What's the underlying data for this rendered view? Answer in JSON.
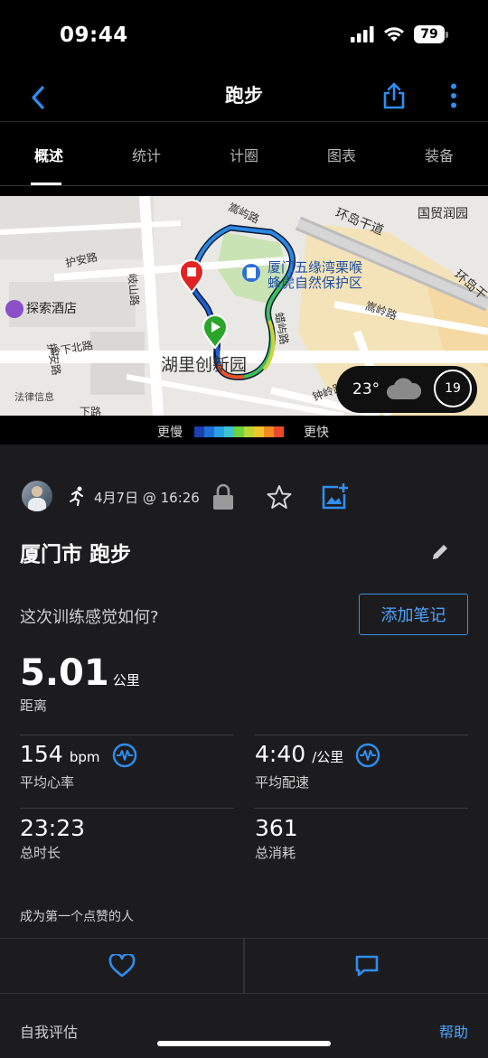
{
  "status_bar": {
    "time": "09:44",
    "battery": "79"
  },
  "nav": {
    "title": "跑步",
    "back_icon": "chevron-left-icon",
    "share_icon": "share-icon",
    "more_icon": "more-vertical-icon"
  },
  "tabs": [
    {
      "label": "概述",
      "active": true
    },
    {
      "label": "统计",
      "active": false
    },
    {
      "label": "计圈",
      "active": false
    },
    {
      "label": "图表",
      "active": false
    },
    {
      "label": "装备",
      "active": false
    }
  ],
  "map": {
    "labels": {
      "road_top": "嵩屿路",
      "ring_road": "环岛干道",
      "ring_road_2": "环岛干",
      "guomao": "国贸润园",
      "huan_road": "护安路",
      "jishan_road": "岐山路",
      "hotel": "探索酒店",
      "ling_north": "岭下北路",
      "huan_road_2": "护安路",
      "xialing": "下岭路",
      "poi_line1": "厦门五缘湾栗喉",
      "poi_line2": "蜂虎自然保护区",
      "songling": "嵩岭路",
      "shuxiang": "蜡屿路",
      "area": "湖里创新园",
      "legal": "法律信息",
      "zhongling": "钟岭路",
      "xiaroad": "下路"
    },
    "weather": {
      "temperature": "23°",
      "condition_icon": "cloud-icon",
      "wind": "19"
    }
  },
  "pace_legend": {
    "slower": "更慢",
    "faster": "更快",
    "colors": [
      "#1a3fb0",
      "#1e6fd6",
      "#2aa0e8",
      "#3cc2d0",
      "#6cd23f",
      "#b7d832",
      "#f0c52a",
      "#f28a22",
      "#ea4a2a"
    ]
  },
  "activity": {
    "date": "4月7日 @ 16:26",
    "title": "厦门市 跑步",
    "feel_question": "这次训练感觉如何?",
    "add_note": "添加笔记",
    "distance": {
      "value": "5.01",
      "unit": "公里",
      "label": "距离"
    },
    "stats": [
      {
        "value": "154",
        "unit": "bpm",
        "label": "平均心率",
        "has_icon": true
      },
      {
        "value": "4:40",
        "unit": "/公里",
        "label": "平均配速",
        "has_icon": true
      },
      {
        "value": "23:23",
        "unit": "",
        "label": "总时长",
        "has_icon": false
      },
      {
        "value": "361",
        "unit": "",
        "label": "总消耗",
        "has_icon": false
      }
    ],
    "likes_text": "成为第一个点赞的人",
    "like_icon": "heart-icon",
    "comment_icon": "comment-icon",
    "self_eval": "自我评估",
    "help": "帮助"
  },
  "colors": {
    "accent": "#3b8fe0",
    "background": "#1c1c1e"
  }
}
